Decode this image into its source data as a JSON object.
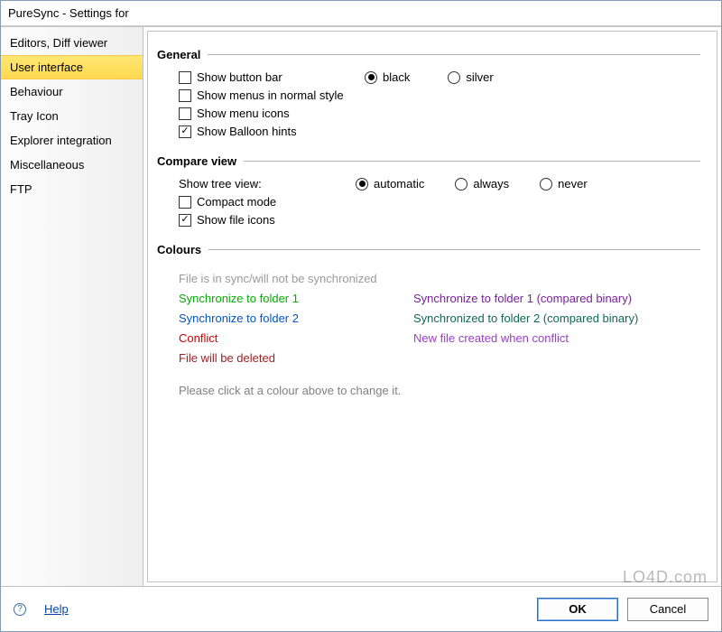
{
  "window": {
    "title": "PureSync - Settings for"
  },
  "sidebar": {
    "items": [
      {
        "label": "Editors, Diff viewer"
      },
      {
        "label": "User interface"
      },
      {
        "label": "Behaviour"
      },
      {
        "label": "Tray Icon"
      },
      {
        "label": "Explorer integration"
      },
      {
        "label": "Miscellaneous"
      },
      {
        "label": "FTP"
      }
    ],
    "selected": "User interface"
  },
  "groups": {
    "general": {
      "title": "General",
      "show_button_bar": {
        "label": "Show button bar",
        "checked": false
      },
      "theme": {
        "options": [
          {
            "label": "black",
            "selected": true
          },
          {
            "label": "silver",
            "selected": false
          }
        ]
      },
      "show_menus_normal": {
        "label": "Show menus in normal style",
        "checked": false
      },
      "show_menu_icons": {
        "label": "Show menu icons",
        "checked": false
      },
      "show_balloon_hints": {
        "label": "Show Balloon hints",
        "checked": true
      }
    },
    "compare": {
      "title": "Compare view",
      "tree_label": "Show tree view:",
      "tree": {
        "options": [
          {
            "label": "automatic",
            "selected": true
          },
          {
            "label": "always",
            "selected": false
          },
          {
            "label": "never",
            "selected": false
          }
        ]
      },
      "compact_mode": {
        "label": "Compact mode",
        "checked": false
      },
      "show_file_icons": {
        "label": "Show file icons",
        "checked": true
      }
    },
    "colours": {
      "title": "Colours",
      "left": [
        {
          "text": "File is in sync/will not be synchronized",
          "color": "#9a9a9a"
        },
        {
          "text": "Synchronize to folder 1",
          "color": "#00b000"
        },
        {
          "text": "Synchronize to folder 2",
          "color": "#0055cc"
        },
        {
          "text": "Conflict",
          "color": "#d00000"
        },
        {
          "text": "File will be deleted",
          "color": "#a02020"
        }
      ],
      "right": [
        {
          "text": "Synchronize to folder 1 (compared binary)",
          "color": "#7a1f9e"
        },
        {
          "text": "Synchronized to folder 2 (compared binary)",
          "color": "#0f6a53"
        },
        {
          "text": "New file created when conflict",
          "color": "#9a3fc4"
        }
      ],
      "hint": "Please click at a colour above to change it."
    }
  },
  "footer": {
    "help": "Help",
    "ok": "OK",
    "cancel": "Cancel"
  },
  "watermark": "LO4D.com"
}
